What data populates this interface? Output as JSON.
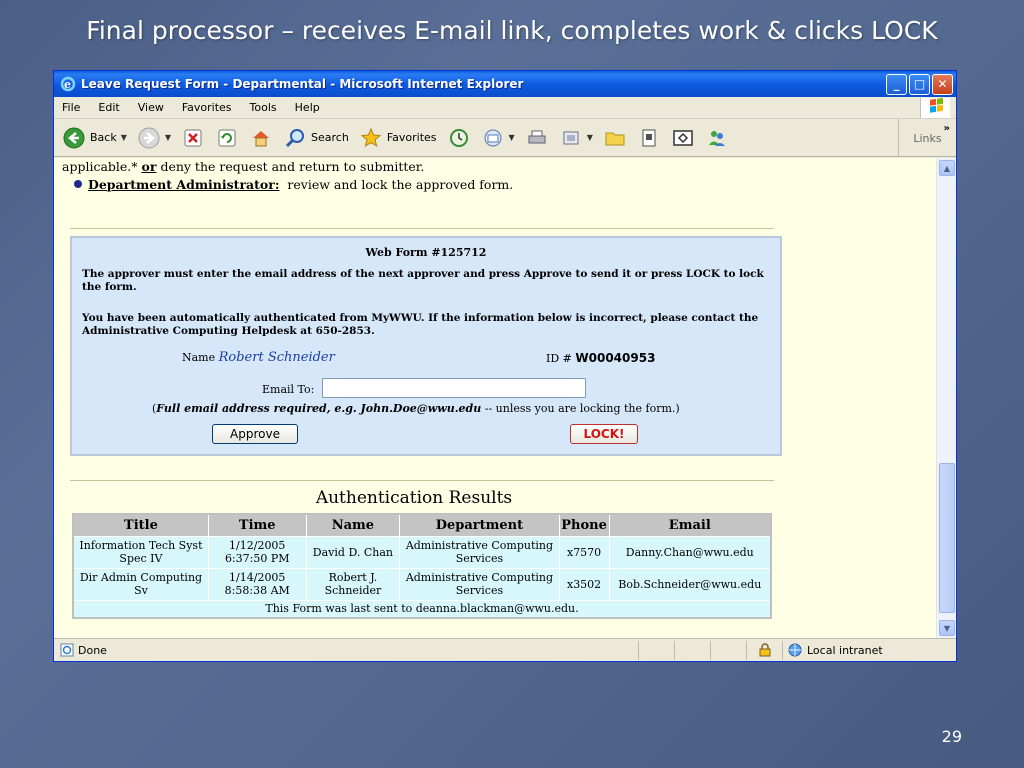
{
  "slide": {
    "title": "Final processor – receives E-mail link, completes work & clicks LOCK",
    "number": "29"
  },
  "window": {
    "title": "Leave Request Form - Departmental - Microsoft Internet Explorer"
  },
  "menu": [
    "File",
    "Edit",
    "View",
    "Favorites",
    "Tools",
    "Help"
  ],
  "toolbar": {
    "back": "Back",
    "search": "Search",
    "favorites": "Favorites",
    "links": "Links"
  },
  "page": {
    "top_line1_a": "applicable.*",
    "top_line1_or": "or",
    "top_line1_b": "deny the request and return to submitter.",
    "dept_admin_label": "Department Administrator:",
    "dept_admin_text": "review and lock the approved form.",
    "webform": {
      "title": "Web Form #125712",
      "para1": "The approver must enter the email address of the next approver and press Approve to send it or press LOCK to lock the form.",
      "para2": "You have been automatically authenticated from MyWWU. If the information below is incorrect, please contact the Administrative Computing Helpdesk at 650-2853.",
      "name_label": "Name",
      "name_value": "Robert Schneider",
      "id_label": "ID #",
      "id_value": "W00040953",
      "email_label": "Email To:",
      "email_value": "",
      "hint_bold": "Full email address required, e.g. John.Doe@wwu.edu",
      "hint_rest": "-- unless you are locking the form.)",
      "approve_label": "Approve",
      "lock_label": "LOCK!"
    },
    "auth": {
      "title": "Authentication Results",
      "headers": [
        "Title",
        "Time",
        "Name",
        "Department",
        "Phone",
        "Email"
      ],
      "rows": [
        [
          "Information Tech Syst Spec IV",
          "1/12/2005 6:37:50 PM",
          "David D. Chan",
          "Administrative Computing Services",
          "x7570",
          "Danny.Chan@wwu.edu"
        ],
        [
          "Dir Admin Computing Sv",
          "1/14/2005 8:58:38 AM",
          "Robert J. Schneider",
          "Administrative Computing Services",
          "x3502",
          "Bob.Schneider@wwu.edu"
        ]
      ],
      "footer": "This Form was last sent to deanna.blackman@wwu.edu."
    }
  },
  "status": {
    "left": "Done",
    "zone": "Local intranet"
  }
}
